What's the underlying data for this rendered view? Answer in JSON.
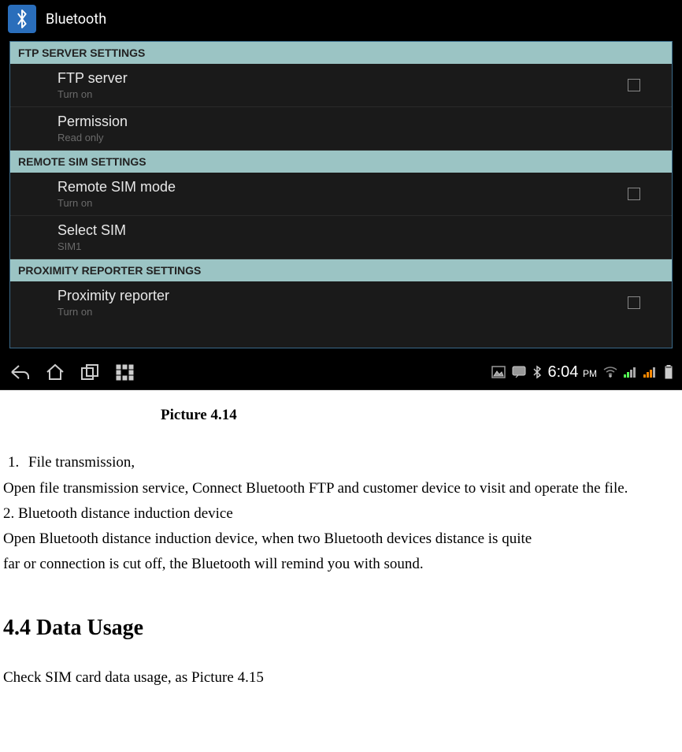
{
  "title_bar": {
    "label": "Bluetooth"
  },
  "sections": [
    {
      "header": "FTP SERVER SETTINGS",
      "items": [
        {
          "primary": "FTP server",
          "secondary": "Turn on",
          "has_checkbox": true
        },
        {
          "primary": "Permission",
          "secondary": "Read only",
          "has_checkbox": false
        }
      ]
    },
    {
      "header": "REMOTE SIM SETTINGS",
      "items": [
        {
          "primary": "Remote SIM mode",
          "secondary": "Turn on",
          "has_checkbox": true
        },
        {
          "primary": "Select SIM",
          "secondary": "SIM1",
          "has_checkbox": false
        }
      ]
    },
    {
      "header": "PROXIMITY REPORTER SETTINGS",
      "items": [
        {
          "primary": "Proximity reporter",
          "secondary": "Turn on",
          "has_checkbox": true
        }
      ]
    }
  ],
  "status_bar": {
    "time": "6:04",
    "ampm": "PM"
  },
  "doc": {
    "caption": "Picture 4.14",
    "item1_num": "1.",
    "item1_text": "File transmission,",
    "para1": "Open file transmission service, Connect Bluetooth FTP and customer device to visit and operate the file.",
    "item2": "2. Bluetooth distance induction device",
    "para2a": "Open Bluetooth distance induction device, when two Bluetooth devices distance is quite",
    "para2b": "far or connection is cut off, the Bluetooth will remind you with sound.",
    "heading": "4.4 Data Usage",
    "para3": "Check SIM card data usage, as Picture 4.15"
  }
}
